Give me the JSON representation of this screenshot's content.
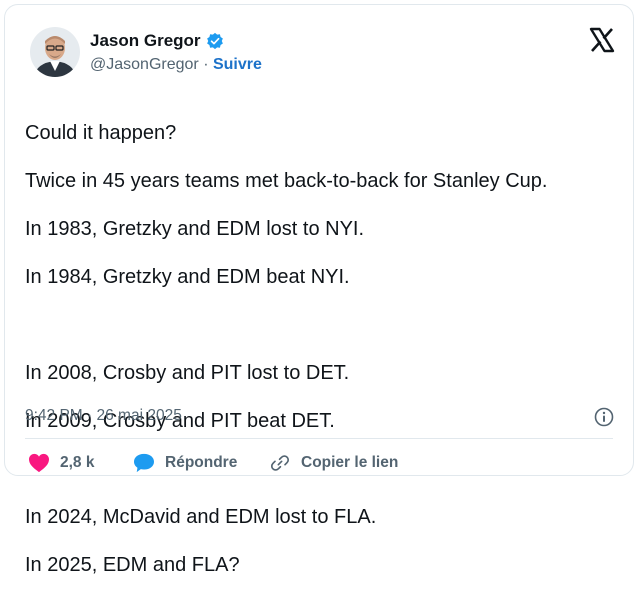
{
  "author": {
    "name": "Jason Gregor",
    "handle": "@JasonGregor",
    "separator": "·",
    "follow_label": "Suivre"
  },
  "tweet": {
    "lines": [
      "Could it happen?",
      "Twice in 45 years teams met back-to-back for Stanley Cup.",
      "In 1983, Gretzky and EDM lost to NYI.",
      "In 1984, Gretzky and EDM beat NYI.",
      "",
      "In 2008, Crosby and PIT lost to DET.",
      "In 2009, Crosby and PIT beat DET.",
      "",
      "In 2024, McDavid and EDM lost to FLA.",
      "In 2025, EDM and FLA?"
    ],
    "timestamp": "9:42 PM · 26 mai 2025"
  },
  "actions": {
    "like_count": "2,8 k",
    "reply_label": "Répondre",
    "copy_link_label": "Copier le lien"
  },
  "icons": {
    "brand": "x-logo-icon",
    "verified": "verified-badge-icon",
    "like": "heart-icon",
    "reply": "speech-bubble-icon",
    "link": "link-icon",
    "info": "info-icon"
  },
  "colors": {
    "verified": "#1d9bf0",
    "follow": "#1d72c9",
    "like": "#f91880",
    "reply": "#1d9bf0",
    "text": "#0f1419",
    "muted": "#536471"
  }
}
